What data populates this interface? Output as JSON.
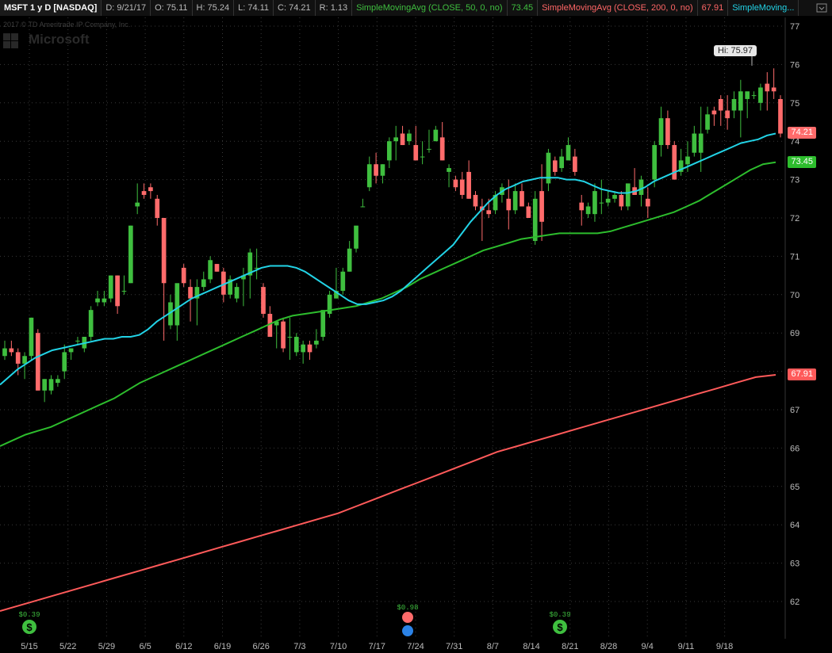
{
  "header": {
    "symbol": "MSFT 1 y D [NASDAQ]",
    "date": "D: 9/21/17",
    "open": "O: 75.11",
    "high": "H: 75.24",
    "low": "L: 74.11",
    "close": "C: 74.21",
    "range": "R: 1.13",
    "sma50_label": "SimpleMovingAvg (CLOSE, 50, 0, no)",
    "sma50_value": "73.45",
    "sma200_label": "SimpleMovingAvg (CLOSE, 200, 0, no)",
    "sma200_value": "67.91",
    "sma_short_label": "SimpleMoving..."
  },
  "watermark": {
    "copyright": "2017 © TD Ameritrade IP Company, Inc.",
    "company": "Microsoft"
  },
  "colors": {
    "up": "#3fbf3f",
    "down": "#ff6b6b",
    "sma_short": "#22d3e6",
    "sma50": "#2dbd2d",
    "sma200": "#ff5a5a",
    "grid": "#3a3a3a"
  },
  "badges": {
    "last_price": "74.21",
    "sma50": "73.45",
    "sma200": "67.91",
    "high": "Hi: 75.97"
  },
  "events": {
    "dividend1": "$0.39",
    "earnings": "$0.98",
    "dividend2": "$0.39"
  },
  "chart_data": {
    "type": "candlestick",
    "ylim": [
      61.5,
      77.5
    ],
    "y_ticks": [
      62,
      63,
      64,
      65,
      66,
      67,
      68,
      69,
      70,
      71,
      72,
      73,
      74,
      75,
      76,
      77
    ],
    "x_ticks": [
      "5/15",
      "5/22",
      "5/29",
      "6/5",
      "6/12",
      "6/19",
      "6/26",
      "7/3",
      "7/10",
      "7/17",
      "7/24",
      "7/31",
      "8/7",
      "8/14",
      "8/21",
      "8/28",
      "9/4",
      "9/11",
      "9/18"
    ],
    "grid": true,
    "candles": [
      [
        68.4,
        68.8,
        68.3,
        68.6
      ],
      [
        68.6,
        68.8,
        68.4,
        68.5
      ],
      [
        68.5,
        68.6,
        67.9,
        68.2
      ],
      [
        68.2,
        68.5,
        67.8,
        68.4
      ],
      [
        68.4,
        69.4,
        68.3,
        69.4
      ],
      [
        69.0,
        69.1,
        67.5,
        67.5
      ],
      [
        67.5,
        67.8,
        67.2,
        67.8
      ],
      [
        67.5,
        67.9,
        67.4,
        67.8
      ],
      [
        67.7,
        67.9,
        67.6,
        67.8
      ],
      [
        68.0,
        68.7,
        67.8,
        68.5
      ],
      [
        68.5,
        68.6,
        68.3,
        68.6
      ],
      [
        68.8,
        68.9,
        68.7,
        68.8
      ],
      [
        68.6,
        68.9,
        68.5,
        68.9
      ],
      [
        68.9,
        69.7,
        68.8,
        69.6
      ],
      [
        69.8,
        70.1,
        69.7,
        69.9
      ],
      [
        69.8,
        70.1,
        69.7,
        69.9
      ],
      [
        69.9,
        70.5,
        69.8,
        70.5
      ],
      [
        70.5,
        70.5,
        69.5,
        69.7
      ],
      [
        70.1,
        70.5,
        70.0,
        70.1
      ],
      [
        70.3,
        71.8,
        70.3,
        71.8
      ],
      [
        72.3,
        72.9,
        72.1,
        72.4
      ],
      [
        72.7,
        72.9,
        72.5,
        72.6
      ],
      [
        72.8,
        72.9,
        72.5,
        72.7
      ],
      [
        72.5,
        72.6,
        71.8,
        72.0
      ],
      [
        72.0,
        72.0,
        68.8,
        70.3
      ],
      [
        69.2,
        70.0,
        69.1,
        69.8
      ],
      [
        69.2,
        70.2,
        68.8,
        70.3
      ],
      [
        70.7,
        70.8,
        70.2,
        70.3
      ],
      [
        70.2,
        70.4,
        69.3,
        69.9
      ],
      [
        69.9,
        70.4,
        69.2,
        70.2
      ],
      [
        70.2,
        70.6,
        70.1,
        70.4
      ],
      [
        70.4,
        71.0,
        70.3,
        70.9
      ],
      [
        70.8,
        70.8,
        70.6,
        70.6
      ],
      [
        70.6,
        70.7,
        69.8,
        70.0
      ],
      [
        70.0,
        70.5,
        69.9,
        70.4
      ],
      [
        69.9,
        70.3,
        69.8,
        70.2
      ],
      [
        70.4,
        70.7,
        69.7,
        70.5
      ],
      [
        70.5,
        71.2,
        69.9,
        71.1
      ],
      [
        70.7,
        71.2,
        70.4,
        70.7
      ],
      [
        70.2,
        70.3,
        69.4,
        69.5
      ],
      [
        69.5,
        69.7,
        68.9,
        68.9
      ],
      [
        69.2,
        69.3,
        68.6,
        69.3
      ],
      [
        69.3,
        69.4,
        68.5,
        68.6
      ],
      [
        68.9,
        69.4,
        68.3,
        68.9
      ],
      [
        68.5,
        69.0,
        68.4,
        68.9
      ],
      [
        68.5,
        68.8,
        68.2,
        68.7
      ],
      [
        68.7,
        68.8,
        68.3,
        68.5
      ],
      [
        68.7,
        69.1,
        68.6,
        68.8
      ],
      [
        68.9,
        69.6,
        68.8,
        69.6
      ],
      [
        69.5,
        70.1,
        69.4,
        70.0
      ],
      [
        69.9,
        70.7,
        69.9,
        70.1
      ],
      [
        70.1,
        70.7,
        70.0,
        70.6
      ],
      [
        70.6,
        71.4,
        70.6,
        71.2
      ],
      [
        71.2,
        71.5,
        71.1,
        71.8
      ],
      [
        72.3,
        72.5,
        72.3,
        72.3
      ],
      [
        72.8,
        73.6,
        72.7,
        73.4
      ],
      [
        73.4,
        73.7,
        72.9,
        73.1
      ],
      [
        73.1,
        73.4,
        72.9,
        73.4
      ],
      [
        73.5,
        74.1,
        73.3,
        74.0
      ],
      [
        74.0,
        74.4,
        73.5,
        74.1
      ],
      [
        74.2,
        74.4,
        73.9,
        73.9
      ],
      [
        74.0,
        74.3,
        73.9,
        74.2
      ],
      [
        73.9,
        74.4,
        73.7,
        73.5
      ],
      [
        73.6,
        74.0,
        73.4,
        73.6
      ],
      [
        73.8,
        74.3,
        73.7,
        73.8
      ],
      [
        74.0,
        74.4,
        74.0,
        74.3
      ],
      [
        74.1,
        74.5,
        73.5,
        73.5
      ],
      [
        73.2,
        73.4,
        72.8,
        73.3
      ],
      [
        73.0,
        73.1,
        72.7,
        72.8
      ],
      [
        73.0,
        73.2,
        72.5,
        72.6
      ],
      [
        73.2,
        73.5,
        72.5,
        72.5
      ],
      [
        72.6,
        72.7,
        72.2,
        72.3
      ],
      [
        72.3,
        72.5,
        71.4,
        72.2
      ],
      [
        72.2,
        72.5,
        72.0,
        72.1
      ],
      [
        72.2,
        72.7,
        72.1,
        72.6
      ],
      [
        72.6,
        72.9,
        72.4,
        72.8
      ],
      [
        72.5,
        73.0,
        71.7,
        72.2
      ],
      [
        72.2,
        72.9,
        72.1,
        72.7
      ],
      [
        72.7,
        72.9,
        72.3,
        72.3
      ],
      [
        72.3,
        72.4,
        72.0,
        72.0
      ],
      [
        71.4,
        72.7,
        71.3,
        72.5
      ],
      [
        72.7,
        73.4,
        71.4,
        71.9
      ],
      [
        72.9,
        73.8,
        72.7,
        73.7
      ],
      [
        73.5,
        73.6,
        73.1,
        73.2
      ],
      [
        73.3,
        73.8,
        73.2,
        73.6
      ],
      [
        73.5,
        74.1,
        73.5,
        73.9
      ],
      [
        73.6,
        73.8,
        73.1,
        73.2
      ],
      [
        72.4,
        72.6,
        71.8,
        72.2
      ],
      [
        72.1,
        72.4,
        72.0,
        72.3
      ],
      [
        72.1,
        72.9,
        71.9,
        72.7
      ],
      [
        72.4,
        73.0,
        72.1,
        72.4
      ],
      [
        72.4,
        72.7,
        72.3,
        72.5
      ],
      [
        72.5,
        72.7,
        72.4,
        72.6
      ],
      [
        72.6,
        72.7,
        72.2,
        72.3
      ],
      [
        72.3,
        72.9,
        72.2,
        72.9
      ],
      [
        72.8,
        73.3,
        72.6,
        72.6
      ],
      [
        72.6,
        73.1,
        72.3,
        73.0
      ],
      [
        72.5,
        72.8,
        72.0,
        72.3
      ],
      [
        73.0,
        74.0,
        72.8,
        73.9
      ],
      [
        73.9,
        74.9,
        73.6,
        74.6
      ],
      [
        74.6,
        74.8,
        73.8,
        73.9
      ],
      [
        73.9,
        74.0,
        73.1,
        73.0
      ],
      [
        73.2,
        73.8,
        73.1,
        73.5
      ],
      [
        73.4,
        74.0,
        73.2,
        73.6
      ],
      [
        73.7,
        74.4,
        73.6,
        74.2
      ],
      [
        73.7,
        74.9,
        73.2,
        74.2
      ],
      [
        74.3,
        74.9,
        74.2,
        74.7
      ],
      [
        74.8,
        74.9,
        74.4,
        74.7
      ],
      [
        75.1,
        75.2,
        74.4,
        74.8
      ],
      [
        74.8,
        75.2,
        74.3,
        74.6
      ],
      [
        74.8,
        75.3,
        74.6,
        75.1
      ],
      [
        74.8,
        75.6,
        74.1,
        75.3
      ],
      [
        75.1,
        75.2,
        74.6,
        75.3
      ],
      [
        75.2,
        75.3,
        75.1,
        75.2
      ],
      [
        75.0,
        75.5,
        74.8,
        75.4
      ],
      [
        75.5,
        75.8,
        74.8,
        75.3
      ],
      [
        75.4,
        75.9,
        75.1,
        75.3
      ],
      [
        75.1,
        75.2,
        74.1,
        74.2
      ]
    ],
    "sma_short": [
      67.65,
      67.85,
      68.05,
      68.2,
      68.35,
      68.45,
      68.55,
      68.6,
      68.65,
      68.7,
      68.75,
      68.8,
      68.85,
      68.85,
      68.9,
      68.9,
      68.95,
      69.1,
      69.3,
      69.45,
      69.6,
      69.75,
      69.9,
      70.0,
      70.1,
      70.2,
      70.3,
      70.4,
      70.5,
      70.6,
      70.7,
      70.75,
      70.75,
      70.75,
      70.7,
      70.6,
      70.45,
      70.3,
      70.15,
      70.0,
      69.85,
      69.75,
      69.75,
      69.8,
      69.85,
      69.95,
      70.1,
      70.3,
      70.5,
      70.7,
      70.9,
      71.1,
      71.3,
      71.6,
      71.9,
      72.15,
      72.4,
      72.6,
      72.75,
      72.85,
      72.95,
      73.0,
      73.05,
      73.05,
      73.05,
      73.0,
      73.0,
      72.95,
      72.85,
      72.75,
      72.7,
      72.65,
      72.65,
      72.7,
      72.8,
      72.95,
      73.05,
      73.15,
      73.25,
      73.35,
      73.45,
      73.55,
      73.65,
      73.75,
      73.85,
      73.95,
      74.0,
      74.05,
      74.15,
      74.2
    ],
    "sma50": [
      66.05,
      66.2,
      66.35,
      66.45,
      66.55,
      66.7,
      66.85,
      67.0,
      67.15,
      67.3,
      67.5,
      67.7,
      67.85,
      68.0,
      68.15,
      68.3,
      68.45,
      68.6,
      68.75,
      68.9,
      69.05,
      69.2,
      69.35,
      69.45,
      69.5,
      69.55,
      69.6,
      69.65,
      69.7,
      69.8,
      69.9,
      70.05,
      70.2,
      70.4,
      70.55,
      70.7,
      70.85,
      71.0,
      71.15,
      71.25,
      71.35,
      71.45,
      71.5,
      71.55,
      71.6,
      71.6,
      71.6,
      71.6,
      71.65,
      71.75,
      71.85,
      71.95,
      72.05,
      72.15,
      72.3,
      72.45,
      72.65,
      72.85,
      73.05,
      73.25,
      73.4,
      73.45
    ],
    "sma200": [
      61.75,
      61.9,
      62.05,
      62.2,
      62.35,
      62.5,
      62.65,
      62.8,
      62.95,
      63.1,
      63.25,
      63.4,
      63.55,
      63.7,
      63.85,
      64.0,
      64.15,
      64.3,
      64.5,
      64.7,
      64.9,
      65.1,
      65.3,
      65.5,
      65.7,
      65.9,
      66.05,
      66.2,
      66.35,
      66.5,
      66.65,
      66.8,
      66.95,
      67.1,
      67.25,
      67.4,
      67.55,
      67.7,
      67.85,
      67.91
    ]
  }
}
